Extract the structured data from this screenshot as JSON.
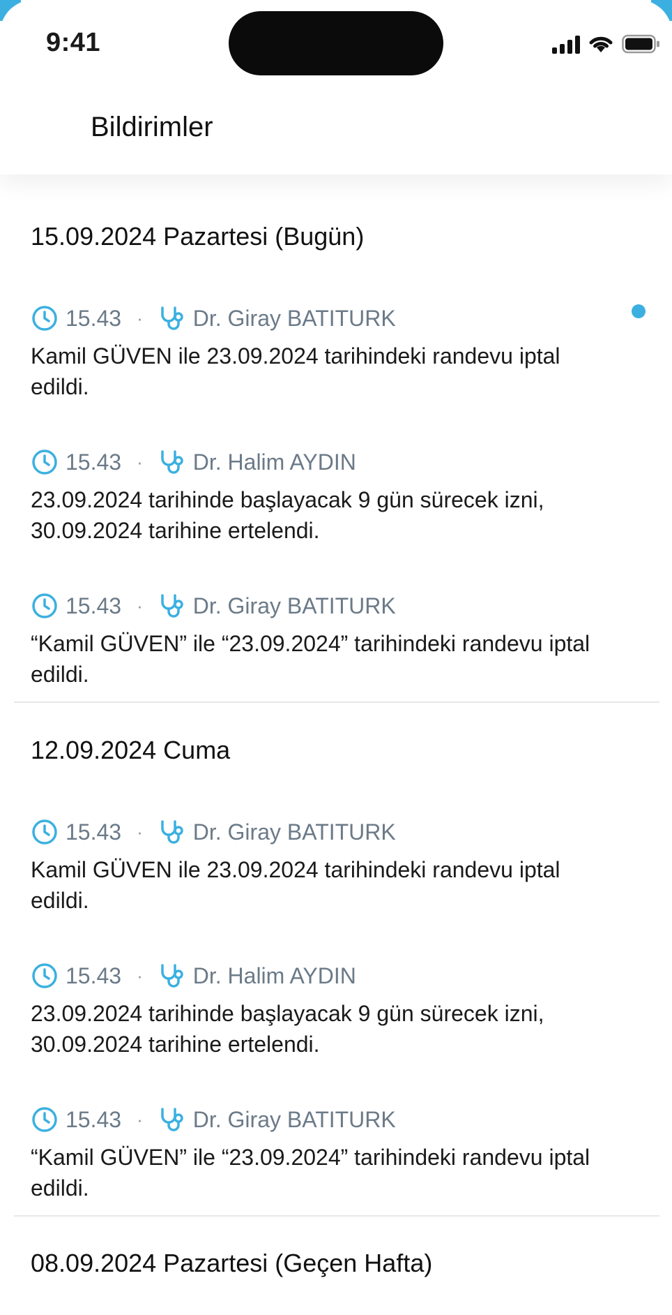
{
  "status_bar": {
    "time": "9:41"
  },
  "header": {
    "title": "Bildirimler"
  },
  "colors": {
    "accent": "#3bb0e0",
    "meta_text": "#6b7a88",
    "divider": "#e6e8ea"
  },
  "groups": [
    {
      "title": "15.09.2024 Pazartesi (Bugün)",
      "items": [
        {
          "time": "15.43",
          "separator": "·",
          "doctor": "Dr. Giray BATITURK",
          "text_line1": "Kamil GÜVEN ile 23.09.2024 tarihindeki randevu iptal",
          "text_line2": "edildi.",
          "unread": true
        },
        {
          "time": "15.43",
          "separator": "·",
          "doctor": "Dr. Halim AYDIN",
          "text_line1": "23.09.2024 tarihinde başlayacak 9 gün sürecek izni,",
          "text_line2": "30.09.2024 tarihine ertelendi.",
          "unread": false
        },
        {
          "time": "15.43",
          "separator": "·",
          "doctor": "Dr. Giray BATITURK",
          "text_line1": "“Kamil GÜVEN” ile “23.09.2024” tarihindeki randevu iptal",
          "text_line2": "edildi.",
          "unread": false
        }
      ]
    },
    {
      "title": "12.09.2024 Cuma",
      "items": [
        {
          "time": "15.43",
          "separator": "·",
          "doctor": "Dr. Giray BATITURK",
          "text_line1": "Kamil GÜVEN ile 23.09.2024 tarihindeki randevu iptal",
          "text_line2": "edildi.",
          "unread": false
        },
        {
          "time": "15.43",
          "separator": "·",
          "doctor": "Dr. Halim AYDIN",
          "text_line1": "23.09.2024 tarihinde başlayacak 9 gün sürecek izni,",
          "text_line2": "30.09.2024 tarihine ertelendi.",
          "unread": false
        },
        {
          "time": "15.43",
          "separator": "·",
          "doctor": "Dr. Giray BATITURK",
          "text_line1": "“Kamil GÜVEN” ile “23.09.2024” tarihindeki randevu iptal",
          "text_line2": "edildi.",
          "unread": false
        }
      ]
    },
    {
      "title": "08.09.2024 Pazartesi (Geçen Hafta)",
      "items": []
    }
  ],
  "icons": {
    "time_icon": "clock-icon",
    "doctor_icon": "stethoscope-icon",
    "unread_icon": "unread-dot-icon"
  }
}
